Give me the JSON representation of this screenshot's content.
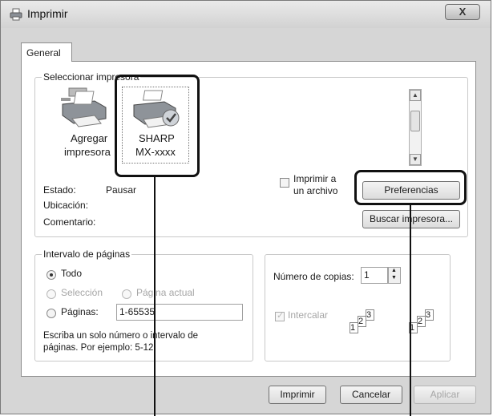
{
  "window": {
    "title": "Imprimir",
    "close_label": "X"
  },
  "tabs": [
    {
      "label": "General"
    }
  ],
  "printer_group": {
    "label": "Seleccionar impresora",
    "printers": [
      {
        "line1": "Agregar",
        "line2": "impresora",
        "icon": "add-printer-icon"
      },
      {
        "line1": "SHARP",
        "line2": "MX-xxxx",
        "icon": "printer-check-icon"
      }
    ],
    "status_label": "Estado:",
    "status_value": "Pausar",
    "location_label": "Ubicación:",
    "comment_label": "Comentario:",
    "print_to_file_line1": "Imprimir a",
    "print_to_file_line2": "un archivo",
    "preferences_button": "Preferencias",
    "find_printer_button": "Buscar impresora..."
  },
  "page_range_group": {
    "label": "Intervalo de páginas",
    "option_all": "Todo",
    "option_selection": "Selección",
    "option_current": "Página actual",
    "option_pages": "Páginas:",
    "pages_value": "1-65535",
    "help_line1": "Escriba un solo número o intervalo de",
    "help_line2": "páginas. Por ejemplo: 5-12"
  },
  "copies_group": {
    "copies_label": "Número de copias:",
    "copies_value": "1",
    "collate_label": "Intercalar",
    "collate_icon_digits": [
      "1",
      "2",
      "3"
    ]
  },
  "footer": {
    "print_button": "Imprimir",
    "cancel_button": "Cancelar",
    "apply_button": "Aplicar"
  }
}
